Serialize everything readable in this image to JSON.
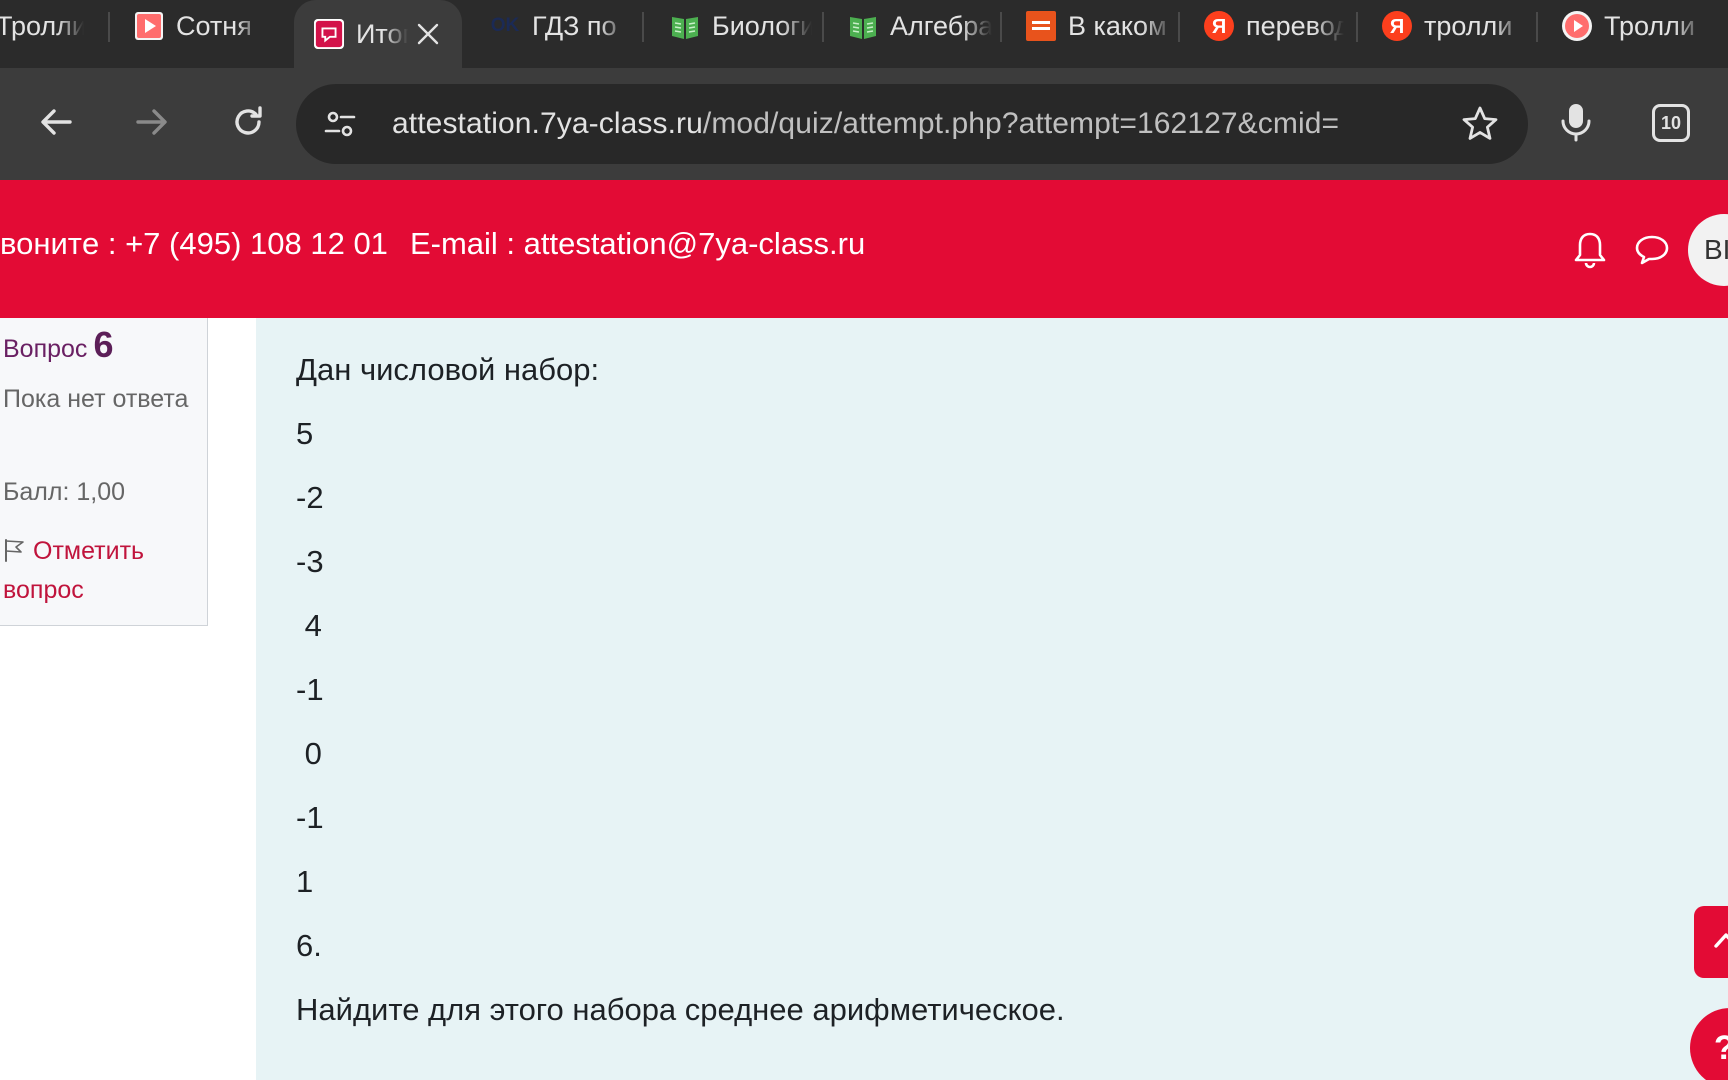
{
  "browser": {
    "tabs": [
      {
        "title": "Тролли",
        "icon": "video-play-icon"
      },
      {
        "title": "Сотня",
        "icon": "video-play-icon"
      },
      {
        "title": "Итоговая",
        "icon": "quiz-site-icon",
        "active": true
      },
      {
        "title": "ГДЗ по",
        "icon": "ok-icon"
      },
      {
        "title": "Биология",
        "icon": "book-icon"
      },
      {
        "title": "Алгебра",
        "icon": "book-icon"
      },
      {
        "title": "В каком",
        "icon": "kinoafisha-icon"
      },
      {
        "title": "перевод",
        "icon": "yandex-icon"
      },
      {
        "title": "тролли",
        "icon": "yandex-icon"
      },
      {
        "title": "Тролли",
        "icon": "video-play-icon"
      }
    ],
    "url_host": "attestation.7ya-class.ru",
    "url_path": "/mod/quiz/attempt.php?attempt=162127&cmid=",
    "tab_count": "10"
  },
  "site": {
    "phone": "вонитe : +7 (495) 108 12 01",
    "email": "E-mail : attestation@7ya-class.ru",
    "avatar_initials": "ВІ",
    "brand_color": "#e30b35"
  },
  "question": {
    "label": "Вопрос",
    "number": "6",
    "state": "Пока нет ответа",
    "grade": "Балл: 1,00",
    "flag_label": "Отметить вопрос",
    "intro": "Дан числовой набор:",
    "numbers": [
      "5",
      "-2",
      "-3",
      " 4",
      "-1",
      " 0",
      "-1",
      "1",
      "6."
    ],
    "task": "Найдите для этого набора среднее арифметическое."
  },
  "help": {
    "label": "?"
  }
}
